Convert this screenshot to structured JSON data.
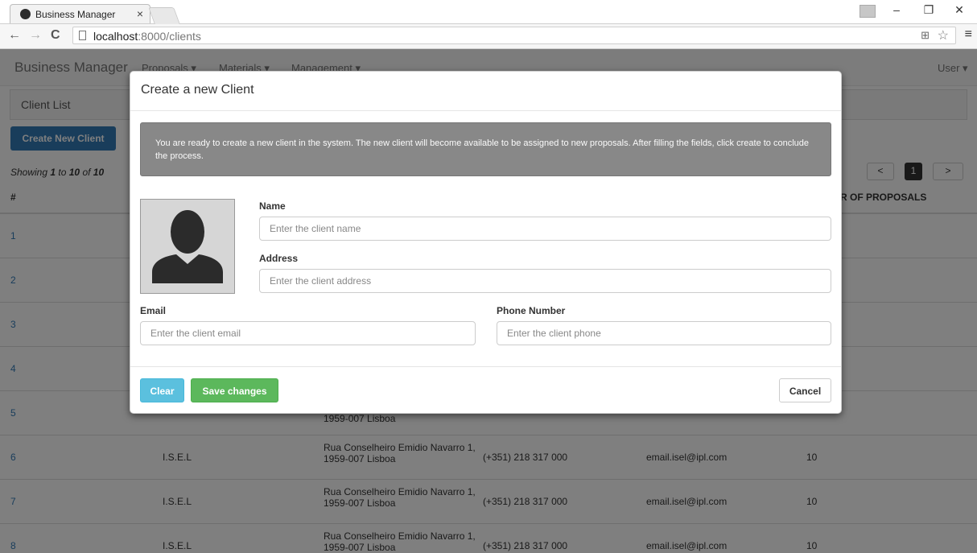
{
  "browser": {
    "tab_title": "Business Manager",
    "tab_close": "×",
    "url_host": "localhost",
    "url_path": ":8000/clients"
  },
  "app": {
    "brand": "Business Manager",
    "nav": [
      "Proposals ▾",
      "Materials ▾",
      "Management ▾"
    ],
    "user_menu": "User ▾",
    "section_title": "Client List",
    "create_button": "Create New Client",
    "showing": {
      "prefix": "Showing ",
      "from": "1",
      "to_word": " to ",
      "to": "10",
      "of_word": " of ",
      "total": "10"
    },
    "pagination": {
      "prev": "<",
      "current": "1",
      "next": ">"
    },
    "table": {
      "headers": {
        "num": "#",
        "proposals": "R OF PROPOSALS"
      },
      "rows": [
        {
          "num": "1",
          "name": "",
          "address_line1": "",
          "address_line2": "",
          "phone": "",
          "email": "",
          "proposals": ""
        },
        {
          "num": "2",
          "name": "",
          "address_line1": "",
          "address_line2": "",
          "phone": "",
          "email": "",
          "proposals": ""
        },
        {
          "num": "3",
          "name": "",
          "address_line1": "",
          "address_line2": "",
          "phone": "",
          "email": "",
          "proposals": ""
        },
        {
          "num": "4",
          "name": "",
          "address_line1": "",
          "address_line2": "",
          "phone": "",
          "email": "",
          "proposals": ""
        },
        {
          "num": "5",
          "name": "",
          "address_line1": "",
          "address_line2": "1959-007 Lisboa",
          "phone": "",
          "email": "",
          "proposals": ""
        },
        {
          "num": "6",
          "name": "I.S.E.L",
          "address_line1": "Rua Conselheiro Emidio Navarro 1,",
          "address_line2": "1959-007 Lisboa",
          "phone": "(+351) 218 317 000",
          "email": "email.isel@ipl.com",
          "proposals": "10"
        },
        {
          "num": "7",
          "name": "I.S.E.L",
          "address_line1": "Rua Conselheiro Emidio Navarro 1,",
          "address_line2": "1959-007 Lisboa",
          "phone": "(+351) 218 317 000",
          "email": "email.isel@ipl.com",
          "proposals": "10"
        },
        {
          "num": "8",
          "name": "I.S.E.L",
          "address_line1": "Rua Conselheiro Emidio Navarro 1,",
          "address_line2": "1959-007 Lisboa",
          "phone": "(+351) 218 317 000",
          "email": "email.isel@ipl.com",
          "proposals": "10"
        }
      ]
    }
  },
  "modal": {
    "title": "Create a new Client",
    "info": "You are ready to create a new client in the system. The new client will become available to be assigned to new proposals. After filling the fields, click create to conclude the process.",
    "name_label": "Name",
    "name_placeholder": "Enter the client name",
    "address_label": "Address",
    "address_placeholder": "Enter the client address",
    "email_label": "Email",
    "email_placeholder": "Enter the client email",
    "phone_label": "Phone Number",
    "phone_placeholder": "Enter the client phone",
    "clear_button": "Clear",
    "save_button": "Save changes",
    "cancel_button": "Cancel"
  }
}
